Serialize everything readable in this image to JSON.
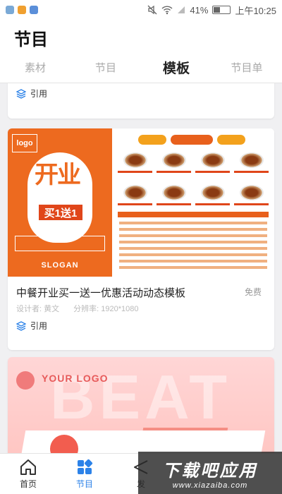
{
  "status": {
    "battery_percent": "41%",
    "battery_level": 0.41,
    "time": "上午10:25"
  },
  "header": {
    "title": "节目"
  },
  "tabs": [
    {
      "label": "素材",
      "active": false
    },
    {
      "label": "节目",
      "active": false
    },
    {
      "label": "模板",
      "active": true
    },
    {
      "label": "节目单",
      "active": false
    }
  ],
  "cards": {
    "prev": {
      "cite_label": "引用"
    },
    "main": {
      "poster_logo": "logo",
      "poster_slogan": "SLOGAN",
      "poster_headline": "开业",
      "poster_deal": "买1送1",
      "title": "中餐开业买一送一优惠活动动态模板",
      "badge": "免费",
      "designer": "设计者: 黄文",
      "resolution": "分辨率: 1920*1080",
      "cite_label": "引用"
    },
    "next": {
      "logo_text": "YOUR LOGO",
      "deco_text": "BEAT"
    }
  },
  "bottom_nav": [
    {
      "label": "首页",
      "icon": "home-icon",
      "active": false
    },
    {
      "label": "节目",
      "icon": "grid-icon",
      "active": true
    },
    {
      "label": "发",
      "icon": "send-icon",
      "active": false
    }
  ],
  "watermark": {
    "text": "下载吧应用",
    "url": "www.xiazaiba.com"
  },
  "colors": {
    "accent_blue": "#2c82e8",
    "poster_orange": "#ed6a1f",
    "promo_pink": "#ffc4c0"
  }
}
